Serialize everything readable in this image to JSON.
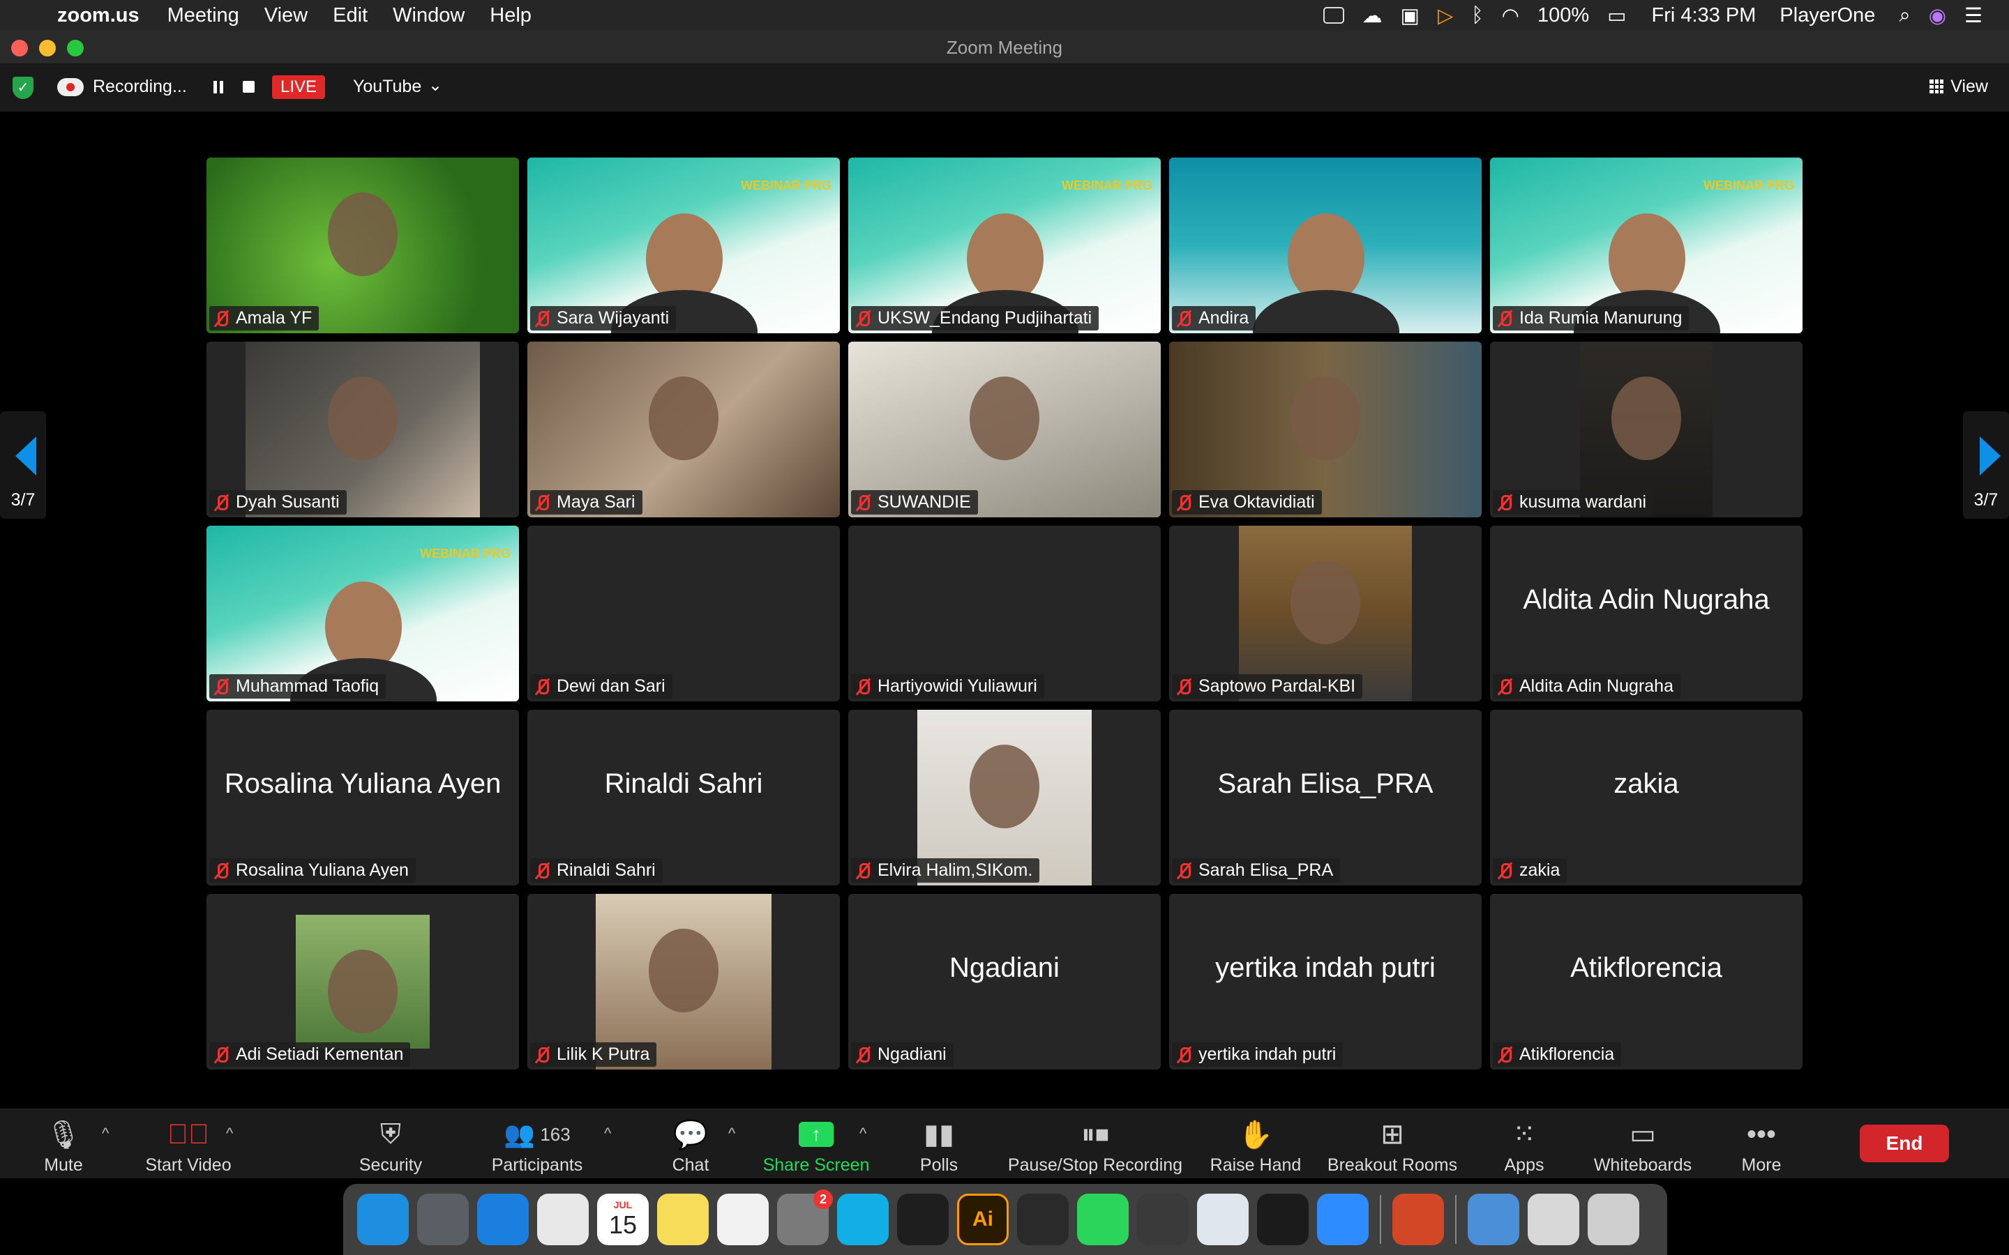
{
  "menubar": {
    "app_name": "zoom.us",
    "menus": [
      "Meeting",
      "View",
      "Edit",
      "Window",
      "Help"
    ],
    "battery": "100%",
    "clock": "Fri 4:33 PM",
    "user": "PlayerOne"
  },
  "window": {
    "title": "Zoom Meeting"
  },
  "topbar": {
    "recording_label": "Recording...",
    "live_label": "LIVE",
    "stream_target": "YouTube",
    "view_label": "View"
  },
  "gallery": {
    "page_indicator": "3/7",
    "participants": [
      {
        "name": "Amala YF",
        "display": "",
        "bg": "green-bg"
      },
      {
        "name": "Sara Wijayanti",
        "display": "",
        "bg": "webinar"
      },
      {
        "name": "UKSW_Endang Pudjihartati",
        "display": "",
        "bg": "webinar"
      },
      {
        "name": "Andira",
        "display": "",
        "bg": "ramadhan"
      },
      {
        "name": "Ida Rumia Manurung",
        "display": "",
        "bg": "webinar"
      },
      {
        "name": "Dyah Susanti",
        "display": "",
        "bg": "room-dark"
      },
      {
        "name": "Maya Sari",
        "display": "",
        "bg": "room-warm"
      },
      {
        "name": "SUWANDIE",
        "display": "",
        "bg": "room-bright"
      },
      {
        "name": "Eva Oktavidiati",
        "display": "",
        "bg": "room-shelf"
      },
      {
        "name": "kusuma wardani",
        "display": "",
        "bg": "room-night"
      },
      {
        "name": "Muhammad Taofiq",
        "display": "",
        "bg": "webinar"
      },
      {
        "name": "Dewi dan Sari",
        "display": "",
        "bg": "blank"
      },
      {
        "name": "Hartiyowidi Yuliawuri",
        "display": "",
        "bg": "blank"
      },
      {
        "name": "Saptowo Pardal-KBI",
        "display": "",
        "bg": "photo-man"
      },
      {
        "name": "Aldita Adin Nugraha",
        "display": "Aldita Adin Nugraha",
        "bg": "blank"
      },
      {
        "name": "Rosalina Yuliana Ayen",
        "display": "Rosalina Yuliana Ayen",
        "bg": "blank"
      },
      {
        "name": "Rinaldi Sahri",
        "display": "Rinaldi Sahri",
        "bg": "blank"
      },
      {
        "name": "Elvira Halim,SIKom.",
        "display": "",
        "bg": "photo-family"
      },
      {
        "name": "Sarah Elisa_PRA",
        "display": "Sarah Elisa_PRA",
        "bg": "blank"
      },
      {
        "name": "zakia",
        "display": "zakia",
        "bg": "blank"
      },
      {
        "name": "Adi Setiadi Kementan",
        "display": "",
        "bg": "photo-park"
      },
      {
        "name": "Lilik K Putra",
        "display": "",
        "bg": "photo-selfie"
      },
      {
        "name": "Ngadiani",
        "display": "Ngadiani",
        "bg": "blank"
      },
      {
        "name": "yertika indah putri",
        "display": "yertika indah putri",
        "bg": "blank"
      },
      {
        "name": "Atikflorencia",
        "display": "Atikflorencia",
        "bg": "blank"
      }
    ]
  },
  "toolbar": {
    "mute": "Mute",
    "start_video": "Start Video",
    "security": "Security",
    "participants": "Participants",
    "participants_count": "163",
    "chat": "Chat",
    "share_screen": "Share Screen",
    "polls": "Polls",
    "pause_stop_recording": "Pause/Stop Recording",
    "raise_hand": "Raise Hand",
    "breakout_rooms": "Breakout Rooms",
    "apps": "Apps",
    "whiteboards": "Whiteboards",
    "more": "More",
    "end": "End"
  },
  "dock": {
    "apps": [
      "Finder",
      "Launchpad",
      "Safari",
      "Chrome",
      "Calendar",
      "Notes",
      "Reminders",
      "System Preferences",
      "Skype",
      "Figma",
      "Illustrator",
      "Instruments",
      "WhatsApp",
      "Screenshot",
      "Preview",
      "QuickTime",
      "Zoom",
      "PowerPoint",
      "Downloads",
      "Documents",
      "Trash"
    ],
    "calendar_day": "15",
    "calendar_month": "JUL",
    "badge": "2",
    "illustrator_label": "Ai"
  },
  "colors": {
    "live_red": "#e02828",
    "end_red": "#d3262b",
    "share_green": "#23d959",
    "nav_blue": "#0e8fe8",
    "muted_red": "#e33333"
  }
}
